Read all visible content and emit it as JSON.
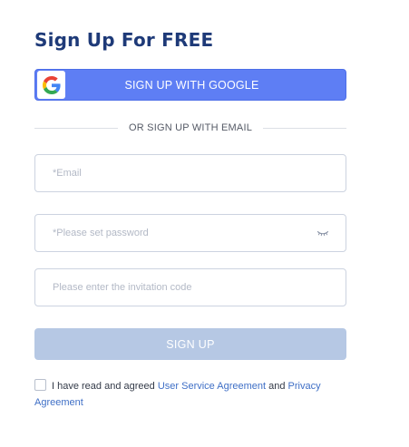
{
  "title": "Sign Up For FREE",
  "google_button": {
    "label": "SIGN UP WITH GOOGLE",
    "icon": "google-g-icon"
  },
  "divider": {
    "text": "OR SIGN UP WITH EMAIL"
  },
  "email": {
    "placeholder": "*Email",
    "value": ""
  },
  "password": {
    "placeholder": "*Please set password",
    "value": "",
    "toggle_icon": "eye-closed-icon"
  },
  "invitation": {
    "placeholder": "Please enter the invitation code",
    "value": ""
  },
  "signup_button": {
    "label": "SIGN UP",
    "state": "disabled"
  },
  "agreement": {
    "checked": false,
    "prefix": "I have read and agreed",
    "link1": "User Service Agreement",
    "conjunction": "and",
    "link2": "Privacy Agreement"
  },
  "colors": {
    "title": "#1e3a78",
    "google_button": "#5e7ef4",
    "signup_button_disabled": "#b6c8e4",
    "link": "#3f6fc6"
  }
}
